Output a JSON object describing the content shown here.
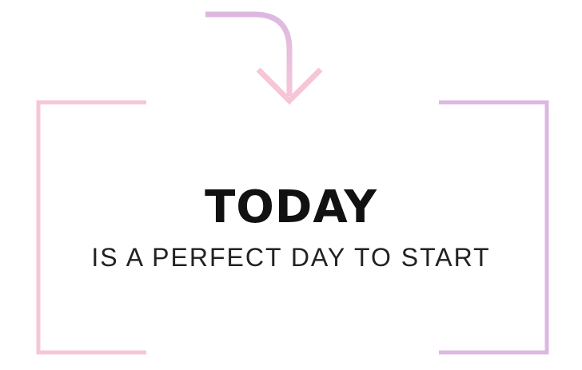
{
  "headline": "TODAY",
  "subline": "IS A PERFECT DAY TO START",
  "colors": {
    "frame_pink": "#f6c6d8",
    "frame_lavender": "#dcb8e0",
    "text": "#111111"
  },
  "icons": [
    "down-arrow-icon"
  ]
}
